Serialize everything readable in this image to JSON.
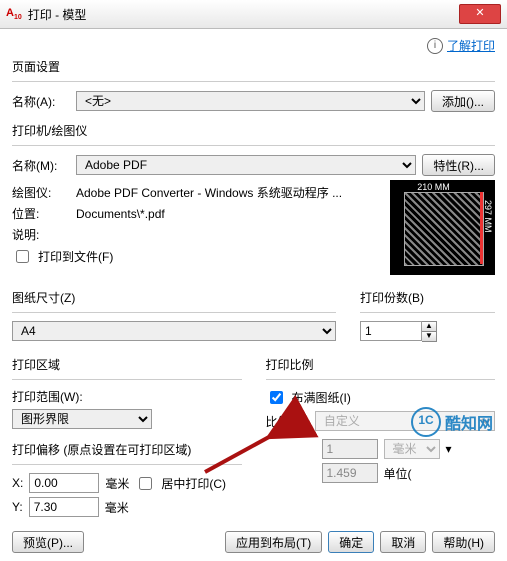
{
  "window": {
    "title": "打印 - 模型"
  },
  "top": {
    "link": "了解打印"
  },
  "pageSetup": {
    "title": "页面设置",
    "nameLabel": "名称(A):",
    "nameValue": "<无>",
    "addBtn": "添加()..."
  },
  "printer": {
    "title": "打印机/绘图仪",
    "nameLabel": "名称(M):",
    "nameValue": "Adobe PDF",
    "propBtn": "特性(R)...",
    "plotterLabel": "绘图仪:",
    "plotterValue": "Adobe PDF Converter - Windows 系统驱动程序 ...",
    "locLabel": "位置:",
    "locValue": "Documents\\*.pdf",
    "descLabel": "说明:",
    "toFileLabel": "打印到文件(F)"
  },
  "preview": {
    "w": "210 MM",
    "h": "297 MM"
  },
  "paper": {
    "title": "图纸尺寸(Z)",
    "value": "A4"
  },
  "copies": {
    "title": "打印份数(B)",
    "value": "1"
  },
  "area": {
    "title": "打印区域",
    "rangeLabel": "打印范围(W):",
    "rangeValue": "图形界限"
  },
  "scale": {
    "title": "打印比例",
    "fitLabel": "布满图纸(I)",
    "ratioLabel": "比例(S):",
    "ratioValue": "自定义",
    "num": "1",
    "unit": "毫米",
    "denom": "1.459",
    "unitLine": "单位("
  },
  "offset": {
    "title": "打印偏移 (原点设置在可打印区域)",
    "xLabel": "X:",
    "xValue": "0.00",
    "yLabel": "Y:",
    "yValue": "7.30",
    "mm": "毫米",
    "centerLabel": "居中打印(C)"
  },
  "footer": {
    "preview": "预览(P)...",
    "apply": "应用到布局(T)",
    "ok": "确定",
    "cancel": "取消",
    "help": "帮助(H)"
  },
  "watermark": {
    "text": "酷知网"
  }
}
